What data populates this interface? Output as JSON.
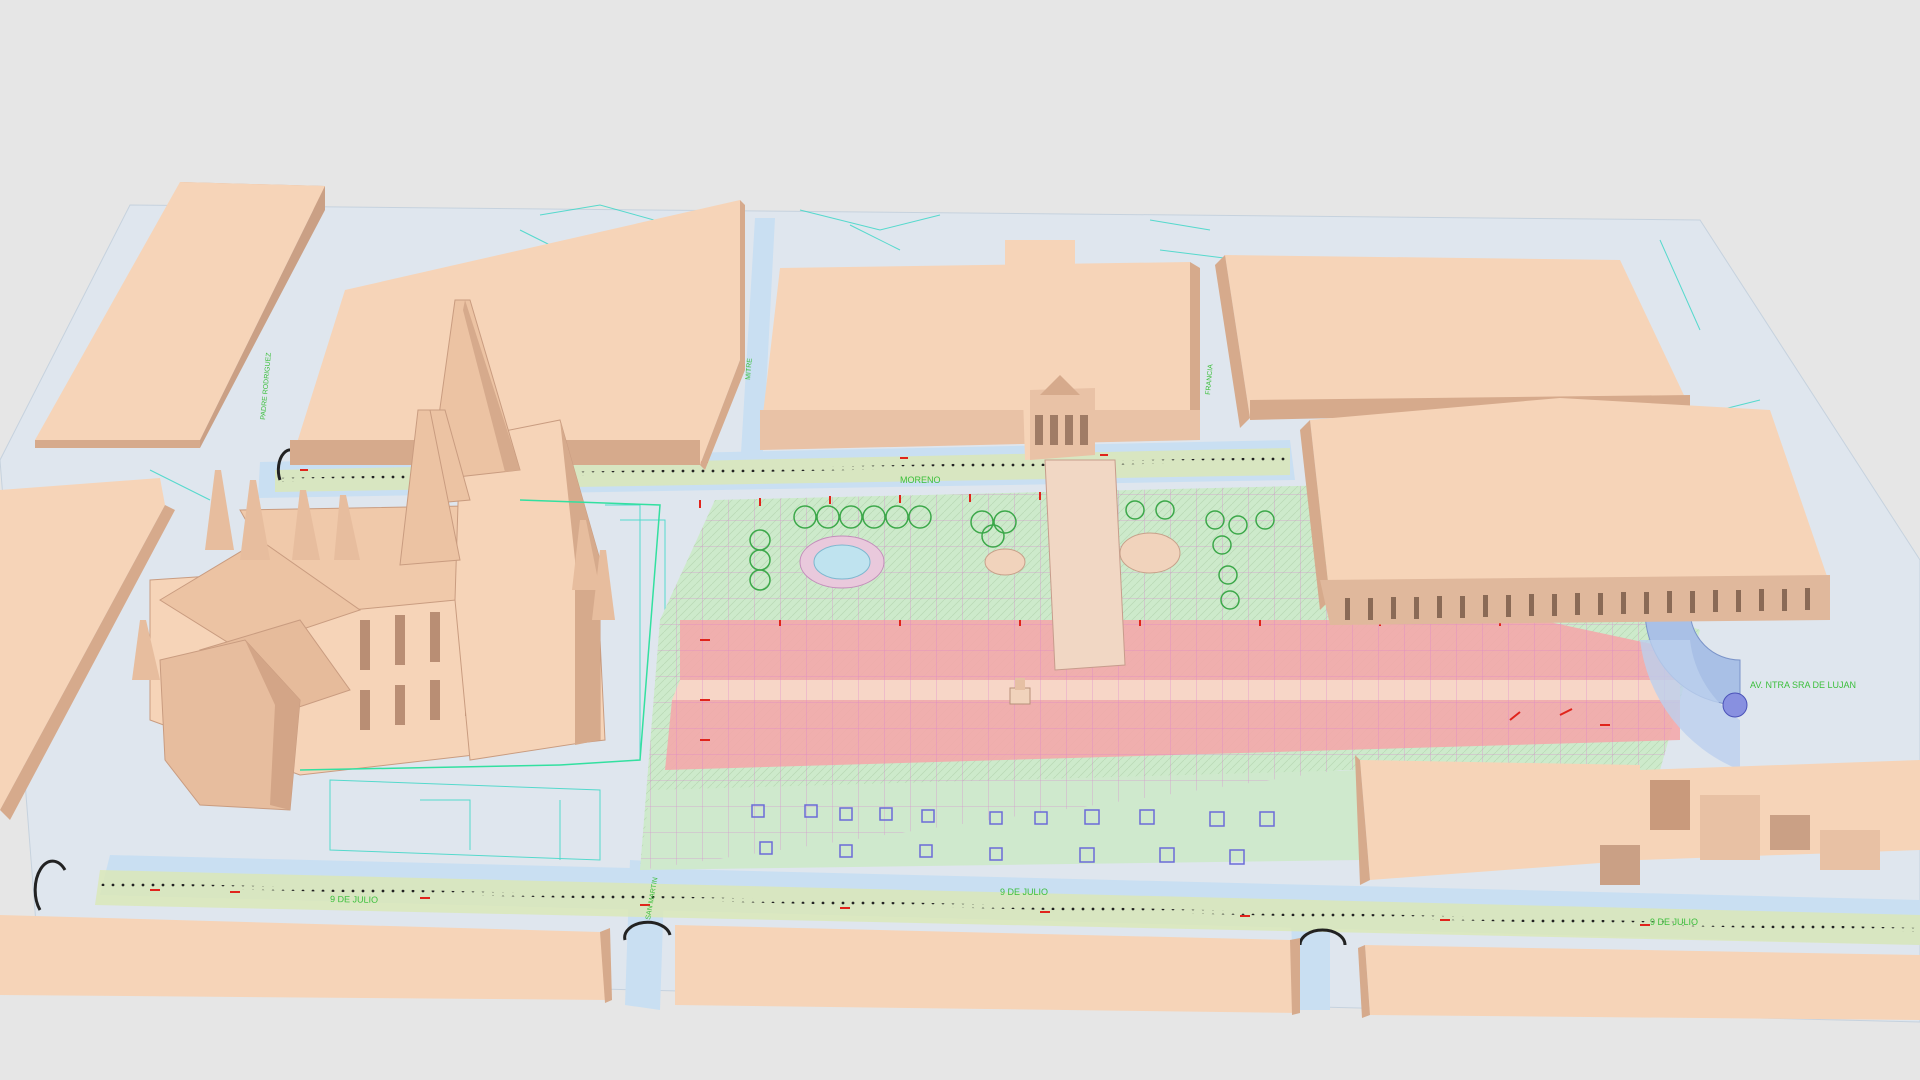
{
  "scene": {
    "colors": {
      "background": "#e6e6e6",
      "ground": "#dfe6ee",
      "building_top": "#f6d4b8",
      "building_side": "#d6aa8c",
      "plaza_red": "#f4a9ab",
      "plaza_green": "#cdeacb",
      "cad_red": "#e0241c",
      "cad_cyan": "#33d6c4",
      "cad_magenta": "#cc66cc",
      "sidewalk": "#d9e6b6"
    },
    "street_labels": {
      "nueve_julio_left": "9 DE JULIO",
      "nueve_julio_center": "9 DE JULIO",
      "nueve_julio_right": "9 DE JULIO",
      "san_martin": "SAN MARTIN",
      "moreno": "MORENO",
      "mitre": "MITRE",
      "francia": "FRANCIA",
      "padre_rodriguez": "PADRE RODRIGUEZ",
      "av_luján": "AV. NTRA SRA DE LUJAN"
    }
  }
}
